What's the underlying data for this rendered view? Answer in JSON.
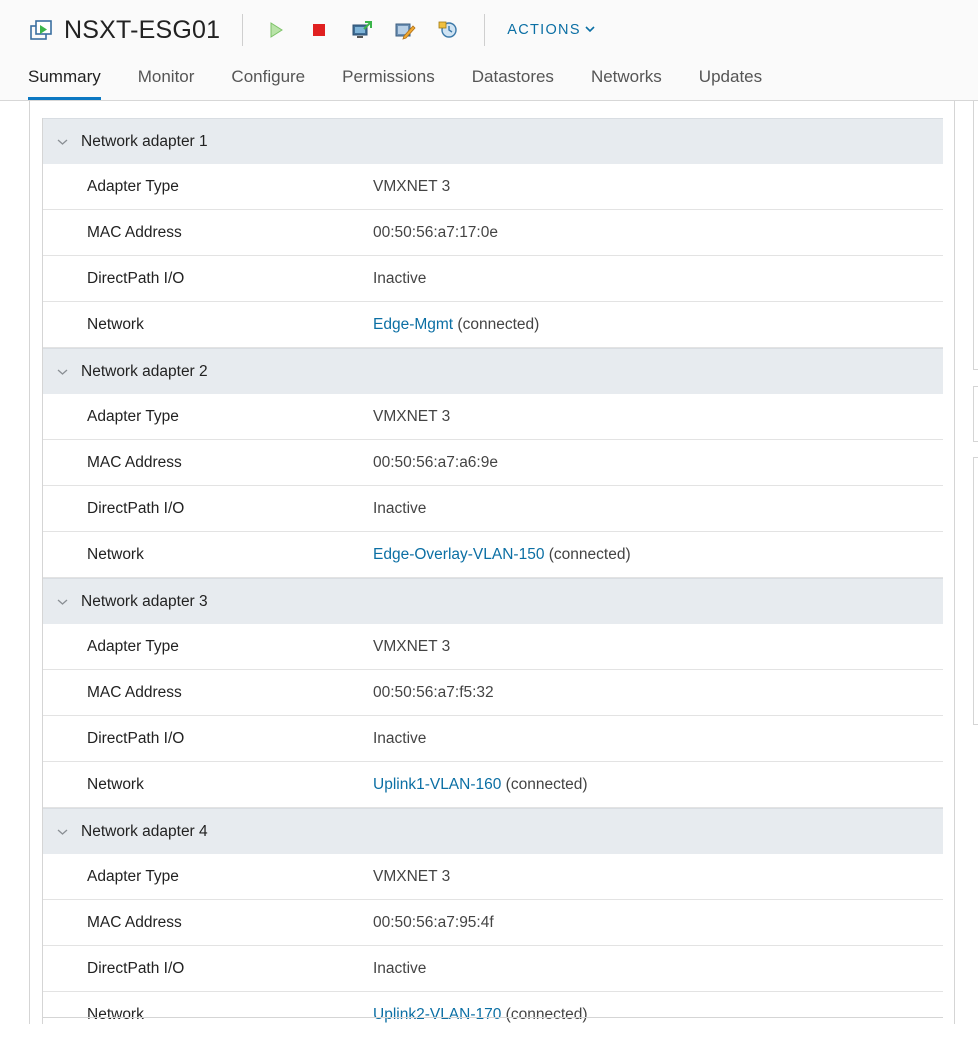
{
  "vm": {
    "name": "NSXT-ESG01"
  },
  "toolbar": {
    "actions_label": "ACTIONS",
    "icons": [
      "power-on-icon",
      "power-off-icon",
      "launch-console-icon",
      "edit-settings-icon",
      "snapshot-icon"
    ]
  },
  "tabs": [
    "Summary",
    "Monitor",
    "Configure",
    "Permissions",
    "Datastores",
    "Networks",
    "Updates"
  ],
  "active_tab": "Summary",
  "adapters": [
    {
      "title": "Network adapter 1",
      "rows": [
        {
          "key": "Adapter Type",
          "value": "VMXNET 3"
        },
        {
          "key": "MAC Address",
          "value": "00:50:56:a7:17:0e"
        },
        {
          "key": "DirectPath I/O",
          "value": "Inactive"
        },
        {
          "key": "Network",
          "link": "Edge-Mgmt",
          "suffix": " (connected)"
        }
      ]
    },
    {
      "title": "Network adapter 2",
      "rows": [
        {
          "key": "Adapter Type",
          "value": "VMXNET 3"
        },
        {
          "key": "MAC Address",
          "value": "00:50:56:a7:a6:9e"
        },
        {
          "key": "DirectPath I/O",
          "value": "Inactive"
        },
        {
          "key": "Network",
          "link": "Edge-Overlay-VLAN-150",
          "suffix": " (connected)"
        }
      ]
    },
    {
      "title": "Network adapter 3",
      "rows": [
        {
          "key": "Adapter Type",
          "value": "VMXNET 3"
        },
        {
          "key": "MAC Address",
          "value": "00:50:56:a7:f5:32"
        },
        {
          "key": "DirectPath I/O",
          "value": "Inactive"
        },
        {
          "key": "Network",
          "link": "Uplink1-VLAN-160",
          "suffix": " (connected)"
        }
      ]
    },
    {
      "title": "Network adapter 4",
      "rows": [
        {
          "key": "Adapter Type",
          "value": "VMXNET 3"
        },
        {
          "key": "MAC Address",
          "value": "00:50:56:a7:95:4f"
        },
        {
          "key": "DirectPath I/O",
          "value": "Inactive"
        },
        {
          "key": "Network",
          "link": "Uplink2-VLAN-170",
          "suffix": " (connected)"
        }
      ]
    }
  ],
  "colors": {
    "accent": "#0b78c2",
    "link": "#0b6fa4",
    "group_bg": "#e7ebef"
  }
}
